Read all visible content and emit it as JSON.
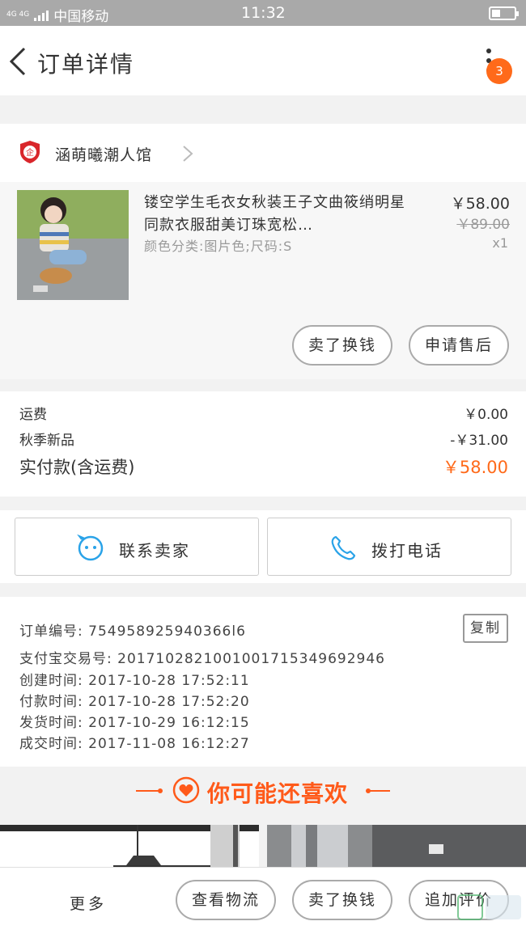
{
  "status_bar": {
    "network": "4G 4G",
    "carrier": "中国移动",
    "time": "11:32"
  },
  "header": {
    "title": "订单详情",
    "badge_count": "3"
  },
  "shop": {
    "name": "涵萌曦潮人馆",
    "logo_text": "企"
  },
  "item": {
    "title": "镂空学生毛衣女秋装王子文曲筱绡明星同款衣服甜美订珠宽松…",
    "sku": "颜色分类:图片色;尺码:S",
    "price": "￥58.00",
    "original_price": "￥89.00",
    "quantity": "x1",
    "actions": [
      "卖了换钱",
      "申请售后"
    ]
  },
  "fees": {
    "rows": [
      {
        "label": "运费",
        "value": "￥0.00"
      },
      {
        "label": "秋季新品",
        "value": "-￥31.00"
      }
    ],
    "total_label": "实付款(含运费)",
    "total_value": "￥58.00"
  },
  "contact": {
    "seller_label": "联系卖家",
    "phone_label": "拨打电话"
  },
  "order_info": {
    "order_no": "订单编号: 754958925940366l6",
    "copy_label": "复制",
    "alipay_no": "支付宝交易号: 2017102821001001715349692946",
    "created": "创建时间: 2017-10-28  17:52:11",
    "paid": "付款时间: 2017-10-28  17:52:20",
    "shipped": "发货时间: 2017-10-29  16:12:15",
    "completed": "成交时间: 2017-11-08  16:12:27"
  },
  "recommend": {
    "title": "你可能还喜欢"
  },
  "bottom_bar": {
    "more_label": "更多",
    "actions": [
      "查看物流",
      "卖了换钱",
      "追加评价"
    ]
  },
  "colors": {
    "accent": "#ff6a1a",
    "blue_icon": "#2aa3e8",
    "shop_logo_red": "#d9262b"
  }
}
